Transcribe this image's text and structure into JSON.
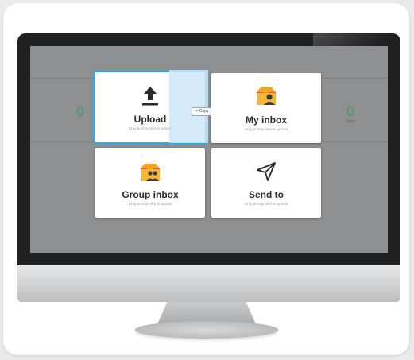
{
  "stats": {
    "left_number": "0",
    "right_number": "0",
    "right_label": "Tasks"
  },
  "tiles": {
    "upload": {
      "title": "Upload",
      "subtitle": "Drag & drop here to upload"
    },
    "my_inbox": {
      "title": "My inbox",
      "subtitle": "Drag & drop here to upload"
    },
    "group_inbox": {
      "title": "Group inbox",
      "subtitle": "Drag & drop here to upload"
    },
    "send_to": {
      "title": "Send to",
      "subtitle": "Drag & drop here to upload"
    }
  },
  "drag": {
    "copy_label": "+ Copy"
  },
  "icons": {
    "upload": "upload-arrow-icon",
    "my_inbox": "inbox-person-icon",
    "group_inbox": "inbox-group-icon",
    "send_to": "paper-plane-icon"
  },
  "colors": {
    "accent": "#36a9de",
    "stat_green": "#3aa55d",
    "inbox_orange": "#f2a31b",
    "inbox_red": "#e5553f"
  }
}
